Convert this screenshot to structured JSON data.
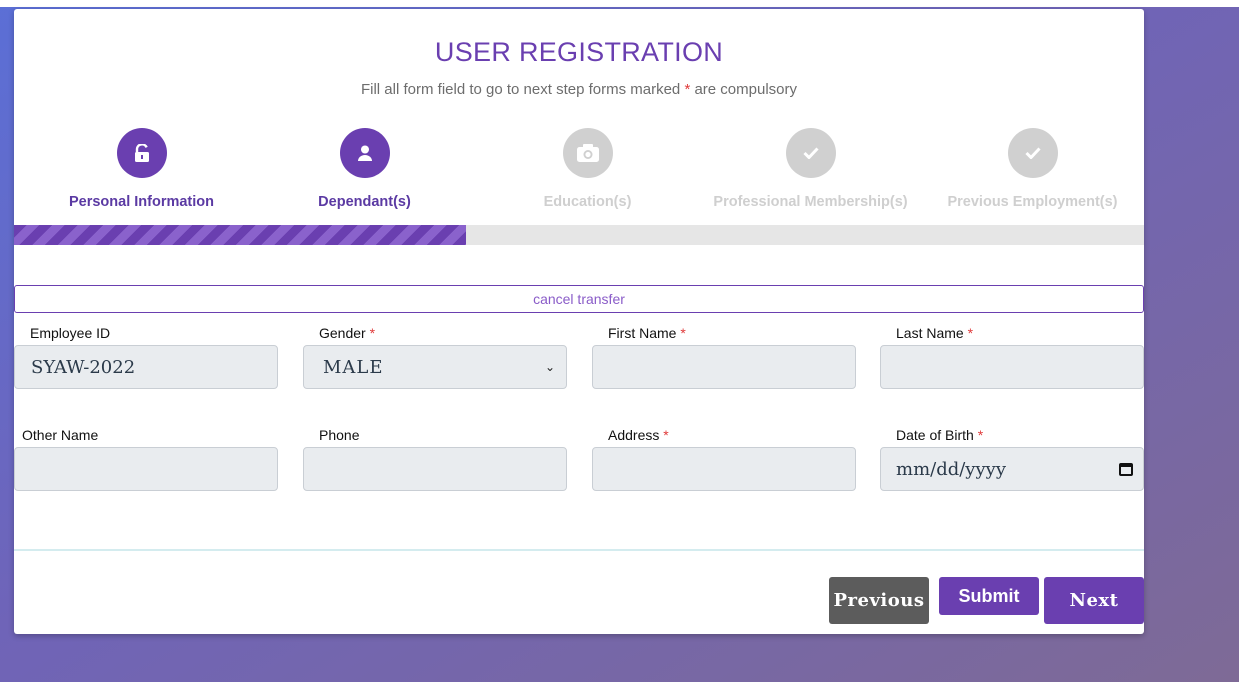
{
  "header": {
    "title": "USER REGISTRATION",
    "subtitle_before": "Fill all form field to go to next step forms marked ",
    "subtitle_asterisk": "*",
    "subtitle_after": " are compulsory"
  },
  "steps": [
    {
      "label": "Personal Information",
      "icon": "unlock-icon",
      "active": true
    },
    {
      "label": "Dependant(s)",
      "icon": "user-icon",
      "active": true
    },
    {
      "label": "Education(s)",
      "icon": "camera-icon",
      "active": false
    },
    {
      "label": "Professional Membership(s)",
      "icon": "check-icon",
      "active": false
    },
    {
      "label": "Previous Employment(s)",
      "icon": "check-icon",
      "active": false
    }
  ],
  "progress": {
    "percent": 40
  },
  "cancel_label": "cancel transfer",
  "required_marker": "*",
  "fields": {
    "employee_id": {
      "label": "Employee ID",
      "value": "SYAW-2022"
    },
    "gender": {
      "label": "Gender",
      "value": "MALE"
    },
    "first_name": {
      "label": "First Name",
      "value": ""
    },
    "last_name": {
      "label": "Last Name",
      "value": ""
    },
    "other_name": {
      "label": "Other Name",
      "value": ""
    },
    "phone": {
      "label": "Phone",
      "value": ""
    },
    "address": {
      "label": "Address",
      "value": ""
    },
    "dob": {
      "label": "Date of Birth",
      "placeholder": "mm/dd/yyyy"
    }
  },
  "buttons": {
    "previous": "Previous",
    "submit": "Submit",
    "next": "Next"
  },
  "colors": {
    "accent": "#6a3fb0",
    "inactive": "#d0d0d0",
    "required": "#e03a3a",
    "previous_button": "#5c5c5c"
  }
}
